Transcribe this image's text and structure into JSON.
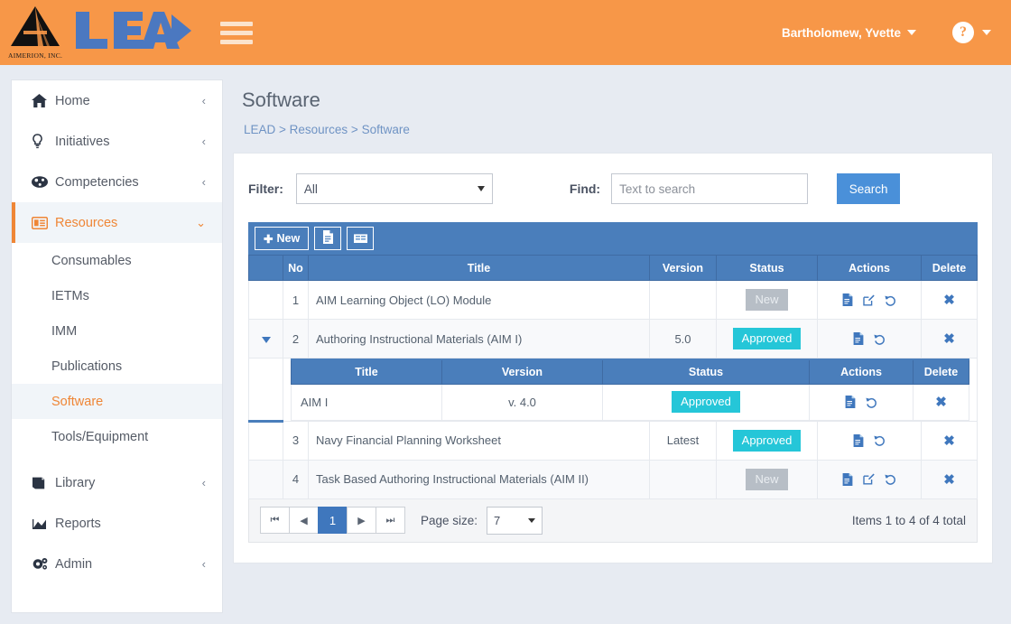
{
  "header": {
    "brand_name": "LEAD",
    "corp_name": "AIMERION, INC.",
    "user_name": "Bartholomew, Yvette",
    "help_glyph": "?"
  },
  "sidebar": {
    "items": [
      {
        "label": "Home",
        "icon": "home-icon",
        "chevron": "‹",
        "active": false
      },
      {
        "label": "Initiatives",
        "icon": "lightbulb-icon",
        "chevron": "‹",
        "active": false
      },
      {
        "label": "Competencies",
        "icon": "puzzle-icon",
        "chevron": "‹",
        "active": false
      },
      {
        "label": "Resources",
        "icon": "id-card-icon",
        "chevron": "⌄",
        "active": true
      }
    ],
    "sub_items": [
      {
        "label": "Consumables",
        "active": false
      },
      {
        "label": "IETMs",
        "active": false
      },
      {
        "label": "IMM",
        "active": false
      },
      {
        "label": "Publications",
        "active": false
      },
      {
        "label": "Software",
        "active": true
      },
      {
        "label": "Tools/Equipment",
        "active": false
      }
    ],
    "items_bottom": [
      {
        "label": "Library",
        "icon": "book-icon",
        "chevron": "‹"
      },
      {
        "label": "Reports",
        "icon": "chart-icon",
        "chevron": ""
      },
      {
        "label": "Admin",
        "icon": "gears-icon",
        "chevron": "‹"
      }
    ]
  },
  "page": {
    "title": "Software",
    "breadcrumb": "LEAD > Resources > Software"
  },
  "filter": {
    "filter_label": "Filter:",
    "filter_value": "All",
    "find_label": "Find:",
    "find_value": "",
    "find_placeholder": "Text to search",
    "search_label": "Search"
  },
  "toolbar": {
    "new_label": "New",
    "new_plus": "✚",
    "icons": [
      "file-document-icon",
      "table-grid-icon"
    ]
  },
  "table": {
    "columns": [
      "",
      "No",
      "Title",
      "Version",
      "Status",
      "Actions",
      "Delete"
    ],
    "rows": [
      {
        "expand": "",
        "no": "1",
        "title": "AIM Learning Object (LO) Module",
        "version": "",
        "status": "New",
        "status_kind": "new",
        "actions": [
          "file-document-icon",
          "edit-pencil-icon",
          "history-revert-icon"
        ],
        "delete": "✖"
      },
      {
        "expand": "▼",
        "no": "2",
        "title": "Authoring Instructional Materials (AIM I)",
        "version": "5.0",
        "status": "Approved",
        "status_kind": "approved",
        "actions": [
          "file-document-icon",
          "history-revert-icon"
        ],
        "delete": "✖"
      },
      {
        "expand": "",
        "no": "3",
        "title": "Navy Financial Planning Worksheet",
        "version": "Latest",
        "status": "Approved",
        "status_kind": "approved",
        "actions": [
          "file-document-icon",
          "history-revert-icon"
        ],
        "delete": "✖"
      },
      {
        "expand": "",
        "no": "4",
        "title": "Task Based Authoring Instructional Materials (AIM II)",
        "version": "",
        "status": "New",
        "status_kind": "new",
        "actions": [
          "file-document-icon",
          "edit-pencil-icon",
          "history-revert-icon"
        ],
        "delete": "✖"
      }
    ],
    "nested": {
      "columns": [
        "Title",
        "Version",
        "Status",
        "Actions",
        "Delete"
      ],
      "rows": [
        {
          "title": "AIM I",
          "version": "v. 4.0",
          "status": "Approved",
          "status_kind": "approved",
          "actions": [
            "file-document-icon",
            "history-revert-icon"
          ],
          "delete": "✖"
        }
      ]
    }
  },
  "pager": {
    "first": "⏮",
    "prev": "◀",
    "current_page": "1",
    "next": "▶",
    "last": "⏭",
    "page_size_label": "Page size:",
    "page_size_value": "7",
    "total_text": "Items 1 to 4 of 4 total"
  },
  "colors": {
    "brand_orange": "#f79748",
    "brand_blue": "#4a7ebb",
    "accent_teal": "#25c6d8",
    "badge_gray": "#b7bec6",
    "page_bg": "#e7ebf2"
  }
}
